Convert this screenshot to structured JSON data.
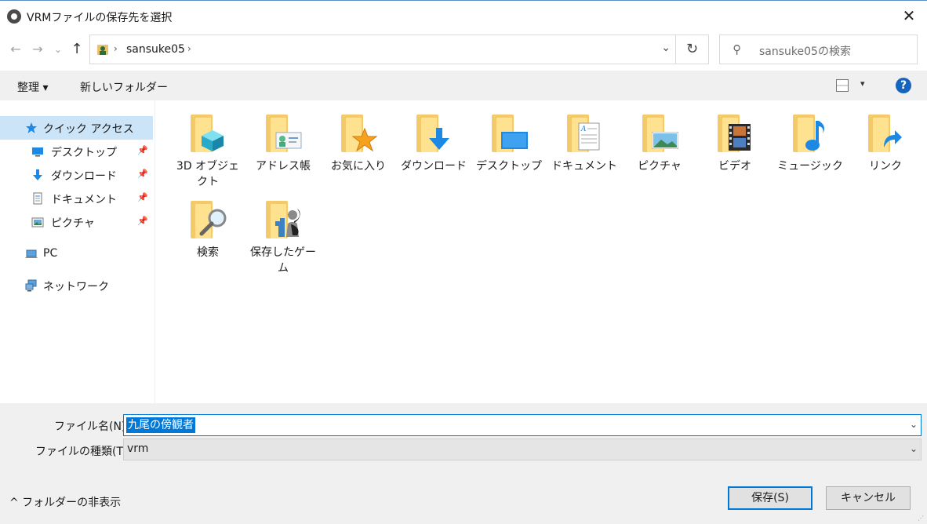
{
  "window": {
    "title": "VRMファイルの保存先を選択",
    "close": "✕"
  },
  "nav": {
    "back": "←",
    "forward": "→",
    "recent": "⌄",
    "up": "↑"
  },
  "address": {
    "path": "sansuke05",
    "sep": "›",
    "dropdown": "⌄",
    "refresh": "↻"
  },
  "search": {
    "placeholder": "sansuke05の検索"
  },
  "command_bar": {
    "organize": "整理 ▾",
    "new_folder": "新しいフォルダー",
    "view_drop": "▾",
    "help": "?"
  },
  "sidebar": {
    "items": [
      {
        "label": "クイック アクセス",
        "icon": "star-icon"
      },
      {
        "label": "デスクトップ",
        "icon": "desktop-icon",
        "pinned": true
      },
      {
        "label": "ダウンロード",
        "icon": "download-icon",
        "pinned": true
      },
      {
        "label": "ドキュメント",
        "icon": "document-icon",
        "pinned": true
      },
      {
        "label": "ピクチャ",
        "icon": "picture-icon",
        "pinned": true
      },
      {
        "label": "PC",
        "icon": "pc-icon"
      },
      {
        "label": "ネットワーク",
        "icon": "network-icon"
      }
    ],
    "pin": "📌"
  },
  "folders": [
    {
      "label": "3D オブジェクト",
      "icon": "3d-objects-folder-icon"
    },
    {
      "label": "アドレス帳",
      "icon": "contacts-folder-icon"
    },
    {
      "label": "お気に入り",
      "icon": "favorites-folder-icon"
    },
    {
      "label": "ダウンロード",
      "icon": "downloads-folder-icon"
    },
    {
      "label": "デスクトップ",
      "icon": "desktop-folder-icon"
    },
    {
      "label": "ドキュメント",
      "icon": "documents-folder-icon"
    },
    {
      "label": "ピクチャ",
      "icon": "pictures-folder-icon"
    },
    {
      "label": "ビデオ",
      "icon": "videos-folder-icon"
    },
    {
      "label": "ミュージック",
      "icon": "music-folder-icon"
    },
    {
      "label": "リンク",
      "icon": "links-folder-icon"
    },
    {
      "label": "検索",
      "icon": "searches-folder-icon"
    },
    {
      "label": "保存したゲーム",
      "icon": "saved-games-folder-icon"
    }
  ],
  "form": {
    "filename_label": "ファイル名(N):",
    "filename_value": "九尾の傍観者",
    "filetype_label": "ファイルの種類(T):",
    "filetype_value": "vrm",
    "dropdown": "⌄"
  },
  "footer": {
    "hide_folders": "^ フォルダーの非表示",
    "save": "保存(S)",
    "cancel": "キャンセル"
  }
}
